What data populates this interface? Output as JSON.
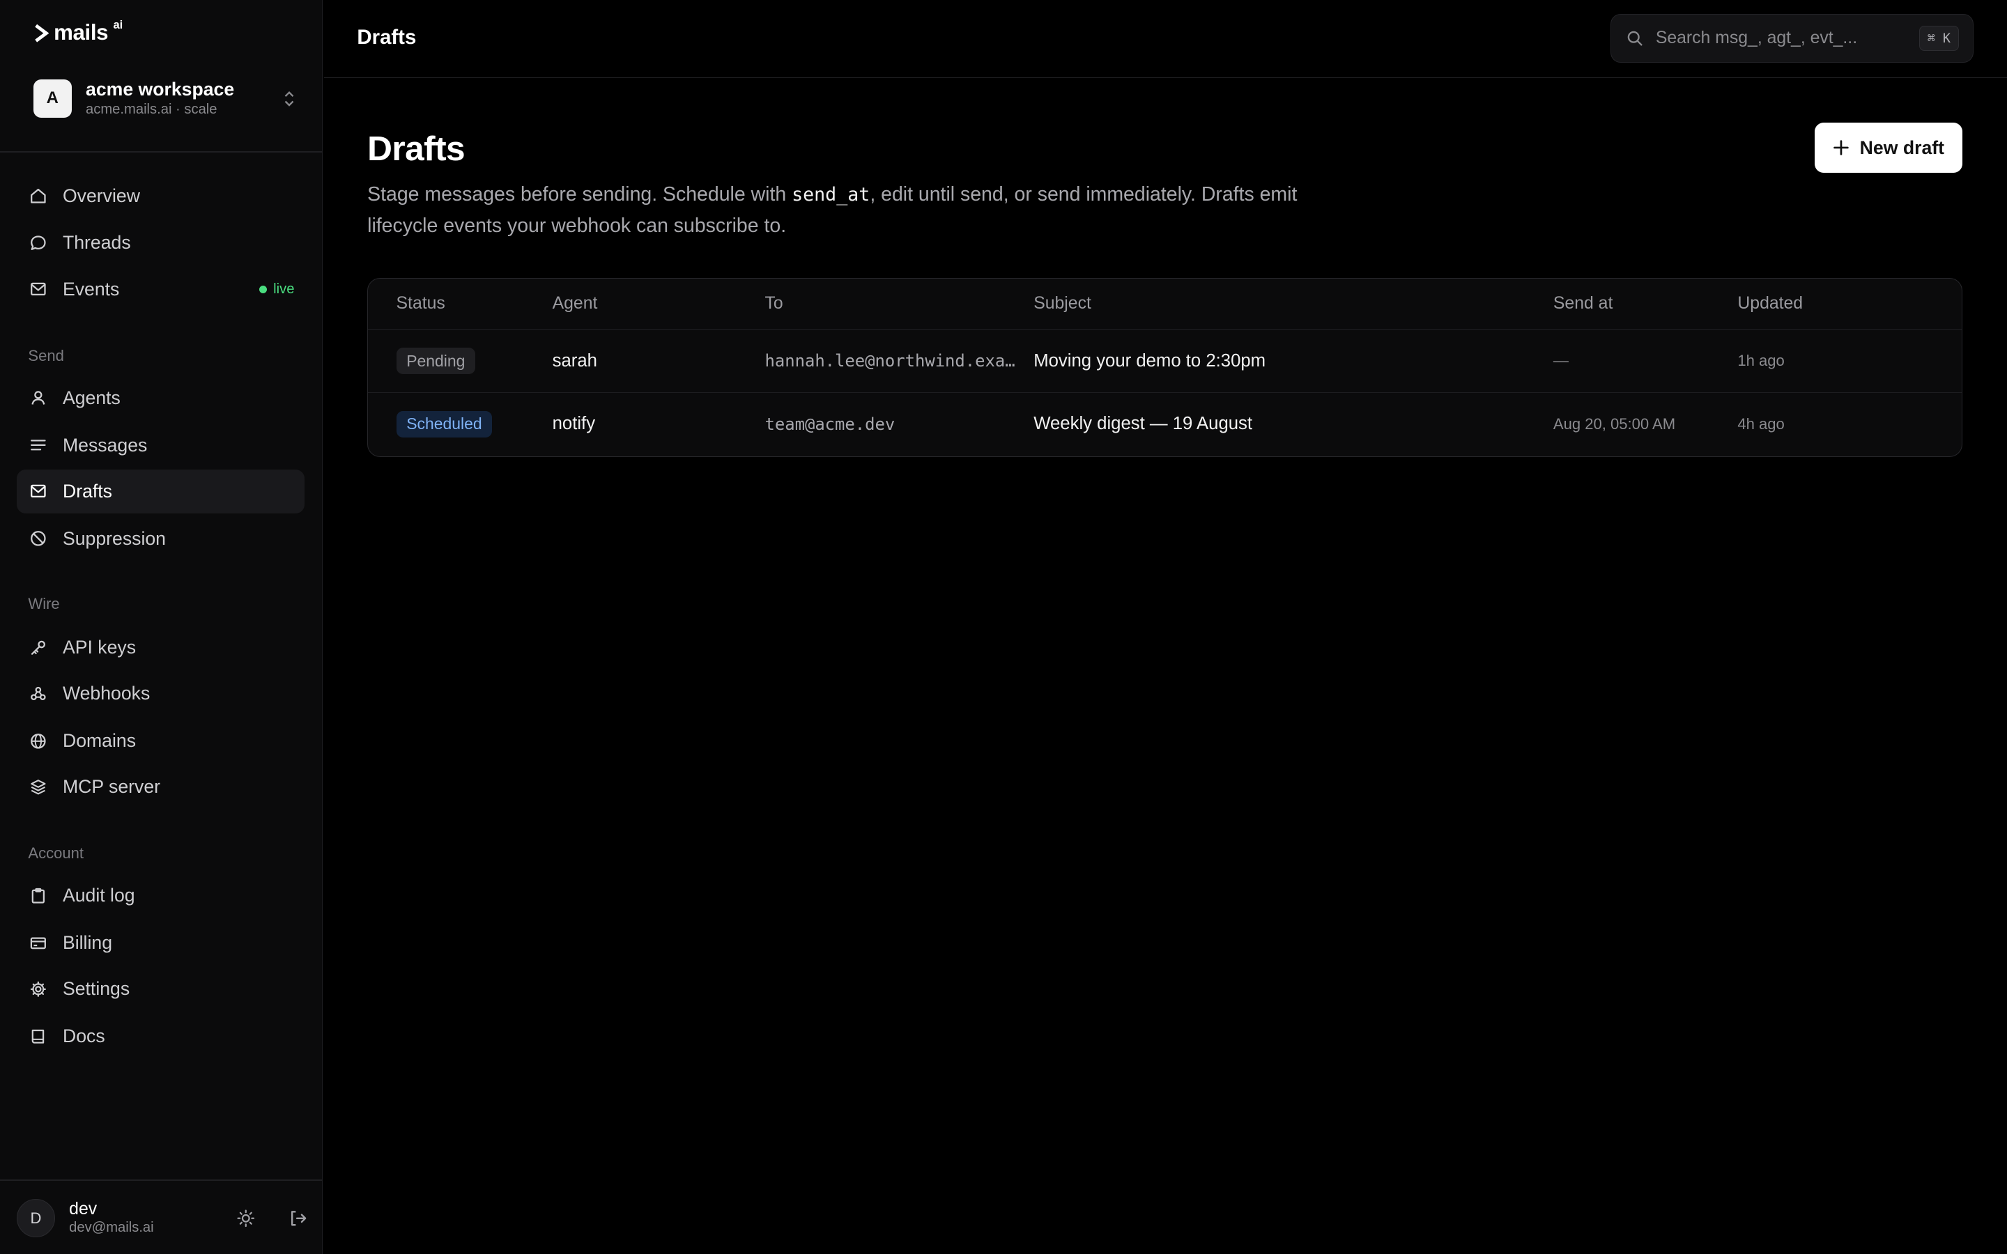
{
  "brand": {
    "name": "mails",
    "sup": "ai"
  },
  "workspace": {
    "initial": "A",
    "name": "acme workspace",
    "sub": "acme.mails.ai · scale"
  },
  "nav": {
    "primary": [
      {
        "label": "Overview",
        "icon": "home-icon"
      },
      {
        "label": "Threads",
        "icon": "chat-bubble-icon"
      },
      {
        "label": "Events",
        "icon": "inbox-icon",
        "badge": "live"
      }
    ],
    "send_label": "Send",
    "send": [
      {
        "label": "Agents",
        "icon": "user-icon"
      },
      {
        "label": "Messages",
        "icon": "lines-icon"
      },
      {
        "label": "Drafts",
        "icon": "mail-icon",
        "active": true
      },
      {
        "label": "Suppression",
        "icon": "ban-icon"
      }
    ],
    "wire_label": "Wire",
    "wire": [
      {
        "label": "API keys",
        "icon": "key-icon"
      },
      {
        "label": "Webhooks",
        "icon": "webhook-icon"
      },
      {
        "label": "Domains",
        "icon": "globe-icon"
      },
      {
        "label": "MCP server",
        "icon": "layers-icon"
      }
    ],
    "account_label": "Account",
    "account": [
      {
        "label": "Audit log",
        "icon": "clipboard-icon"
      },
      {
        "label": "Billing",
        "icon": "credit-card-icon"
      },
      {
        "label": "Settings",
        "icon": "gear-icon"
      },
      {
        "label": "Docs",
        "icon": "book-icon"
      }
    ]
  },
  "user": {
    "initial": "D",
    "name": "dev",
    "email": "dev@mails.ai"
  },
  "topbar": {
    "title": "Drafts",
    "search_placeholder": "Search msg_, agt_, evt_...",
    "shortcut": "⌘ K"
  },
  "page": {
    "title": "Drafts",
    "desc_before": "Stage messages before sending. Schedule with ",
    "desc_code": "send_at",
    "desc_after": ", edit until send, or send immediately. Drafts emit lifecycle events your webhook can subscribe to.",
    "new_button": "New draft"
  },
  "table": {
    "columns": [
      "Status",
      "Agent",
      "To",
      "Subject",
      "Send at",
      "Updated"
    ],
    "rows": [
      {
        "status": "Pending",
        "status_kind": "pending",
        "agent": "sarah",
        "to": "hannah.lee@northwind.example",
        "subject": "Moving your demo to 2:30pm",
        "send_at": "—",
        "updated": "1h ago"
      },
      {
        "status": "Scheduled",
        "status_kind": "scheduled",
        "agent": "notify",
        "to": "team@acme.dev",
        "subject": "Weekly digest — 19 August",
        "send_at": "Aug 20, 05:00 AM",
        "updated": "4h ago"
      }
    ]
  },
  "colors": {
    "background": "#000000",
    "sidebar": "#0b0b0c",
    "accent_live": "#4ade80",
    "scheduled_badge": "#7fb2f5"
  }
}
